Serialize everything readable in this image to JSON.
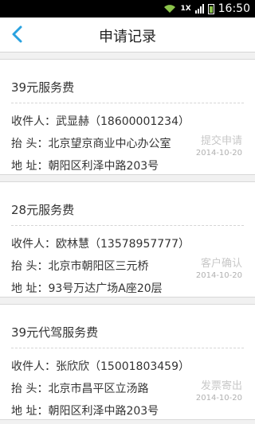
{
  "statusbar": {
    "network": "1X",
    "time": "16:50"
  },
  "header": {
    "title": "申请记录"
  },
  "records": [
    {
      "title": "39元服务费",
      "recipient_label": "收件人：",
      "recipient": "武显赫（18600001234）",
      "heading_label": "抬  头：",
      "heading": "北京望京商业中心办公室",
      "address_label": "地  址：",
      "address": "朝阳区利泽中路203号",
      "status": "提交申请",
      "date": "2014-10-20"
    },
    {
      "title": "28元服务费",
      "recipient_label": "收件人：",
      "recipient": "欧林慧（13578957777）",
      "heading_label": "抬  头：",
      "heading": "北京市朝阳区三元桥",
      "address_label": "地  址：",
      "address": "93号万达广场A座20层",
      "status": "客户确认",
      "date": "2014-10-20"
    },
    {
      "title": "39元代驾服务费",
      "recipient_label": "收件人：",
      "recipient": "张欣欣（15001803459）",
      "heading_label": "抬  头：",
      "heading": "北京市昌平区立汤路",
      "address_label": "地  址：",
      "address": "朝阳区利泽中路203号",
      "status": "发票寄出",
      "date": "2014-10-20"
    }
  ],
  "colors": {
    "accent": "#2aa2e0",
    "status_text": "#c8c8c8"
  }
}
